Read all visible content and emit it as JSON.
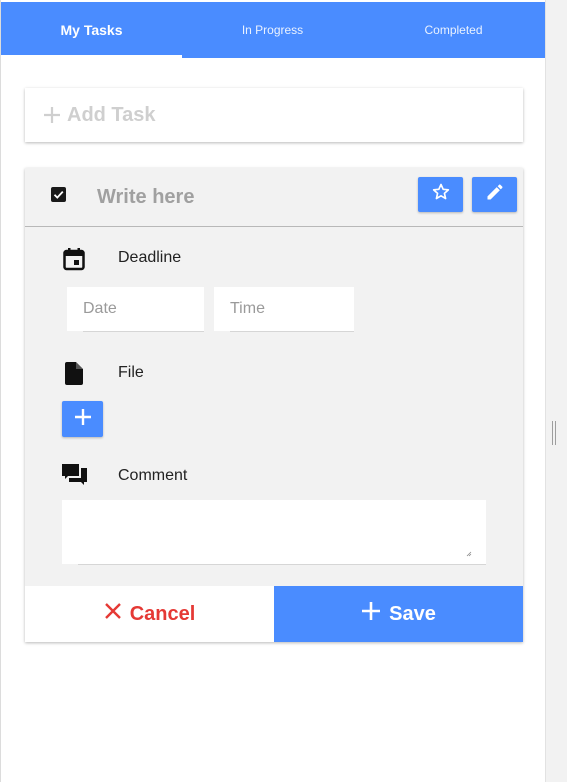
{
  "tabs": [
    {
      "label": "My Tasks",
      "active": true
    },
    {
      "label": "In Progress",
      "active": false
    },
    {
      "label": "Completed",
      "active": false
    }
  ],
  "add_task": {
    "icon": "plus-icon",
    "placeholder": "Add Task"
  },
  "task": {
    "checked": true,
    "title_placeholder": "Write here",
    "actions": [
      {
        "icon": "star-outline-icon"
      },
      {
        "icon": "pencil-icon"
      }
    ],
    "deadline": {
      "label": "Deadline",
      "icon": "calendar-icon",
      "date_placeholder": "Date",
      "time_placeholder": "Time"
    },
    "file": {
      "label": "File",
      "icon": "file-icon",
      "add_icon": "plus-icon"
    },
    "comment": {
      "label": "Comment",
      "icon": "comment-icon",
      "value": ""
    }
  },
  "footer": {
    "cancel_label": "Cancel",
    "save_label": "Save"
  },
  "colors": {
    "primary": "#4a8cff",
    "danger": "#e53935",
    "card_background": "#f2f2f2"
  }
}
